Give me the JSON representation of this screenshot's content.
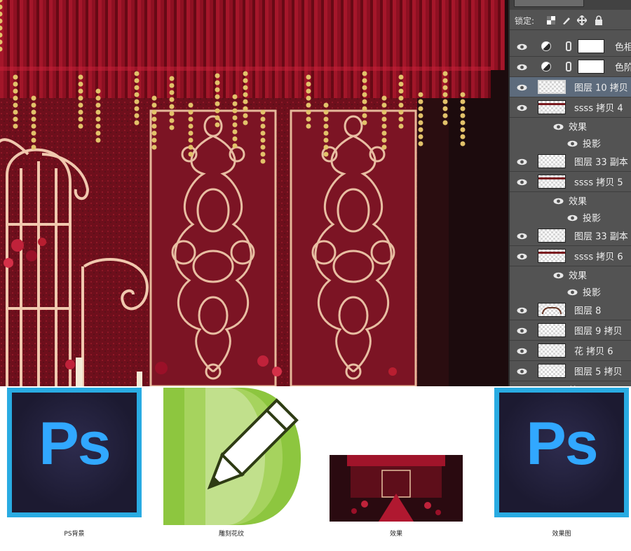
{
  "layers_panel": {
    "lock_label": "锁定:",
    "layers": [
      {
        "name": "色相",
        "kind": "adjustment",
        "selected": false
      },
      {
        "name": "色阶",
        "kind": "adjustment",
        "selected": false
      },
      {
        "name": "图层 10 拷贝",
        "kind": "layer",
        "selected": true
      },
      {
        "name": "ssss 拷贝 4",
        "kind": "layer",
        "thumb": "band"
      },
      {
        "name": "效果",
        "kind": "effect-group"
      },
      {
        "name": "投影",
        "kind": "effect"
      },
      {
        "name": "图层 33 副本",
        "kind": "layer"
      },
      {
        "name": "ssss 拷贝 5",
        "kind": "layer",
        "thumb": "band"
      },
      {
        "name": "效果",
        "kind": "effect-group"
      },
      {
        "name": "投影",
        "kind": "effect"
      },
      {
        "name": "图层 33 副本",
        "kind": "layer"
      },
      {
        "name": "ssss 拷贝 6",
        "kind": "layer",
        "thumb": "band"
      },
      {
        "name": "效果",
        "kind": "effect-group"
      },
      {
        "name": "投影",
        "kind": "effect"
      },
      {
        "name": "图层 8",
        "kind": "layer",
        "thumb": "arc"
      },
      {
        "name": "图层 9 拷贝",
        "kind": "layer"
      },
      {
        "name": "花 拷贝 6",
        "kind": "layer"
      },
      {
        "name": "图层 5 拷贝",
        "kind": "layer"
      },
      {
        "name": "效果",
        "kind": "effect-group"
      }
    ]
  },
  "files": [
    {
      "icon": "photoshop-icon",
      "badge": "Ps",
      "caption": "PS背景"
    },
    {
      "icon": "coreldraw-icon",
      "caption": "雕刻花纹"
    },
    {
      "icon": "render-thumbnail",
      "caption": "效果"
    },
    {
      "icon": "photoshop-icon",
      "badge": "Ps",
      "caption": "效果图"
    }
  ],
  "colors": {
    "ps_border": "#29abe2",
    "ps_letters": "#31a8ff",
    "corel_green": "#8dc63f",
    "stage_red": "#7a1320",
    "panel_bg": "#535353"
  }
}
